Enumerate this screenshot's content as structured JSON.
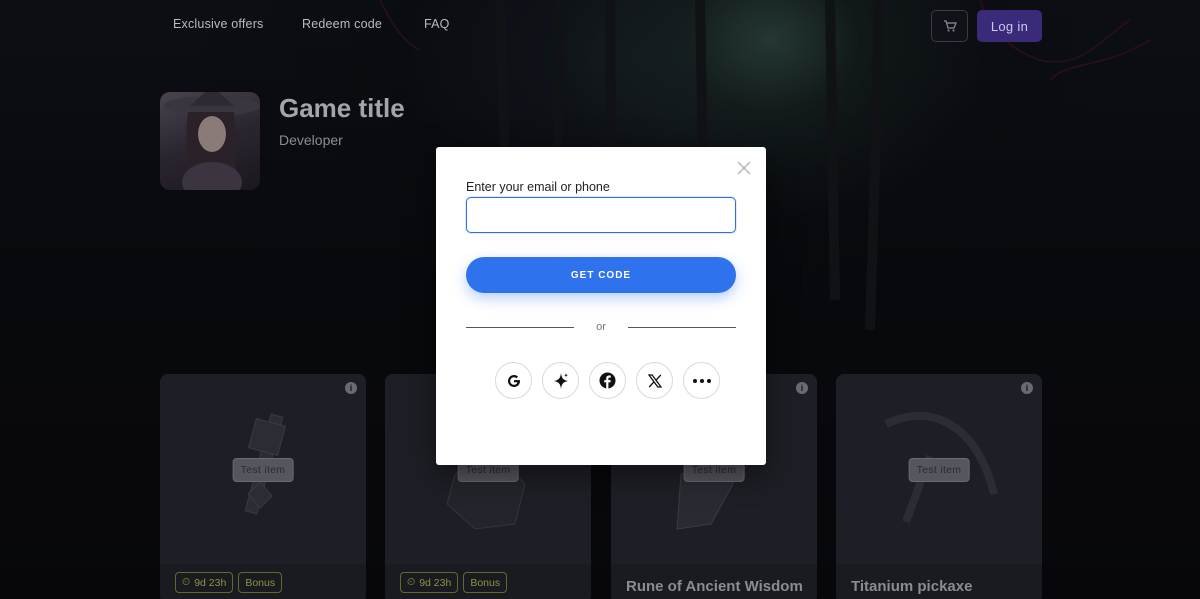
{
  "nav": {
    "items": [
      "Exclusive offers",
      "Redeem code",
      "FAQ"
    ]
  },
  "header": {
    "cart_icon": "cart-icon",
    "login_label": "Log in"
  },
  "game": {
    "title": "Game title",
    "developer": "Developer"
  },
  "cards": [
    {
      "badge": "Test item",
      "timer": "9d 23h",
      "bonus": "Bonus",
      "name": ""
    },
    {
      "badge": "Test item",
      "timer": "9d 23h",
      "bonus": "Bonus",
      "name": ""
    },
    {
      "badge": "Test item",
      "timer": "",
      "bonus": "",
      "name": "Rune of Ancient Wisdom"
    },
    {
      "badge": "Test item",
      "timer": "",
      "bonus": "",
      "name": "Titanium pickaxe"
    }
  ],
  "modal": {
    "label": "Enter your email or phone",
    "input_value": "",
    "input_placeholder": "",
    "button_label": "GET CODE",
    "divider_text": "or",
    "socials": [
      "google-icon",
      "sparkle-icon",
      "facebook-icon",
      "x-icon",
      "more-icon"
    ]
  },
  "colors": {
    "accent": "#2f72ee",
    "login_bg": "#3b2a7a",
    "tag": "#8a9440"
  }
}
